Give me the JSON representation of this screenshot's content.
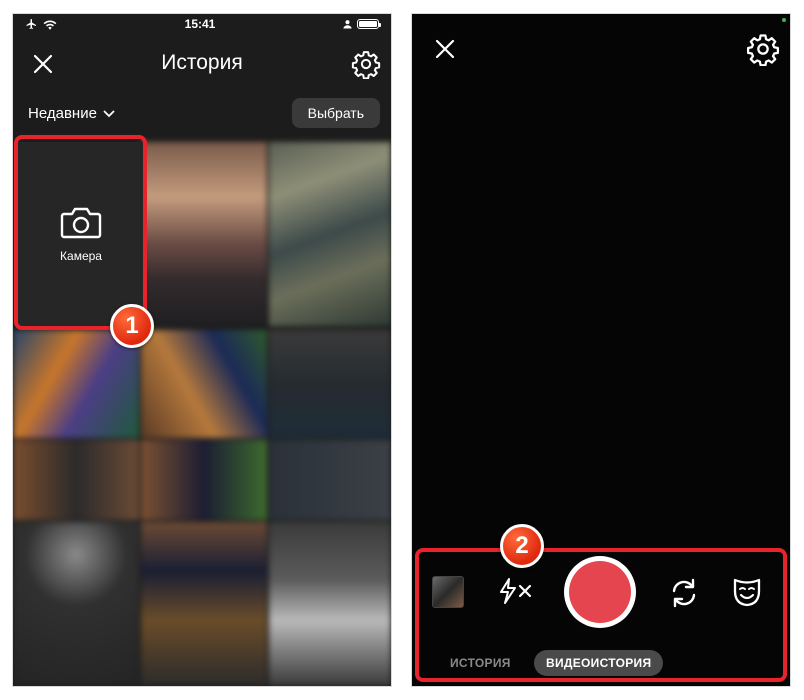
{
  "left_screen": {
    "status_bar": {
      "time": "15:41"
    },
    "header": {
      "title": "История",
      "close_icon": "close-icon",
      "settings_icon": "gear-icon"
    },
    "filter": {
      "label": "Недавние",
      "select_button": "Выбрать"
    },
    "camera_tile": {
      "label": "Камера",
      "icon": "camera-icon"
    },
    "badge": "1"
  },
  "right_screen": {
    "controls": {
      "gallery_thumb": "gallery-thumbnail",
      "flash_icon": "flash-off-icon",
      "flip_icon": "flip-camera-icon",
      "mask_icon": "mask-icon",
      "record_color": "#e5454f"
    },
    "modes": {
      "story": "ИСТОРИЯ",
      "video_story": "ВИДЕОИСТОРИЯ"
    },
    "badge": "2"
  },
  "colors": {
    "highlight": "#e8232c",
    "badge": "#e0280f"
  }
}
